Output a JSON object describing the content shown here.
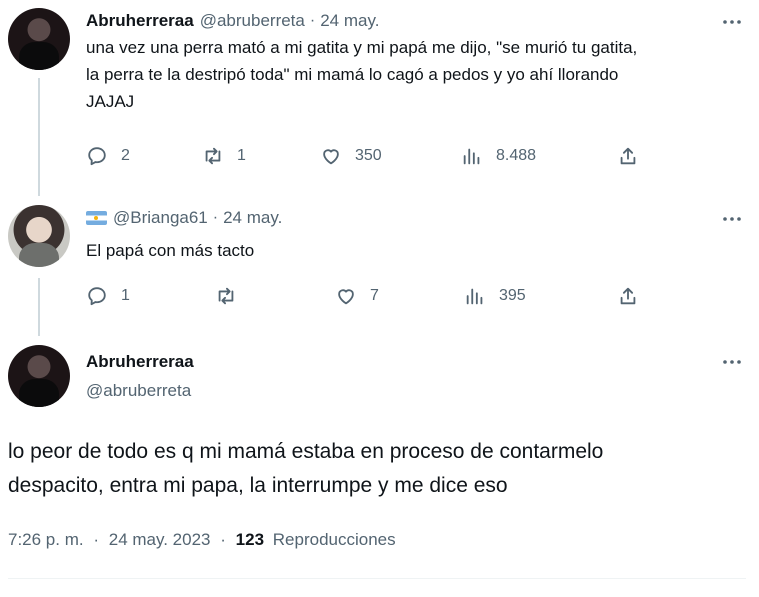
{
  "tweet1": {
    "display_name": "Abruherreraa",
    "handle": "@abruberreta",
    "separator": "·",
    "date": "24 may.",
    "text_lines": [
      "una vez una perra mató a mi gatita y mi papá me dijo, \"se murió tu gatita,",
      "la perra te la destripó toda\" mi mamá lo cagó a pedos y yo ahí llorando",
      "JAJAJ"
    ],
    "replies": "2",
    "retweets": "1",
    "likes": "350",
    "views": "8.488"
  },
  "tweet2": {
    "handle": "@Brianga61",
    "separator": "·",
    "date": "24 may.",
    "text": "El papá con más tacto",
    "replies": "1",
    "likes": "7",
    "views": "395"
  },
  "tweet3": {
    "display_name": "Abruherreraa",
    "handle": "@abruberreta",
    "text_lines": [
      "lo peor de todo es q mi mamá estaba en proceso de contarmelo",
      "despacito, entra mi papa, la interrumpe y me dice eso"
    ],
    "time": "7:26 p. m.",
    "date": "24 may. 2023",
    "separator": "·",
    "views_count": "123",
    "views_label": "Reproducciones"
  },
  "icons": [
    "more-icon",
    "reply-icon",
    "retweet-icon",
    "like-icon",
    "views-icon",
    "share-icon",
    "argentina-flag-icon"
  ],
  "colors": {
    "text": "#0f1419",
    "secondary": "#536471",
    "thread_line": "#cfd9de",
    "divider": "#eff3f4"
  }
}
